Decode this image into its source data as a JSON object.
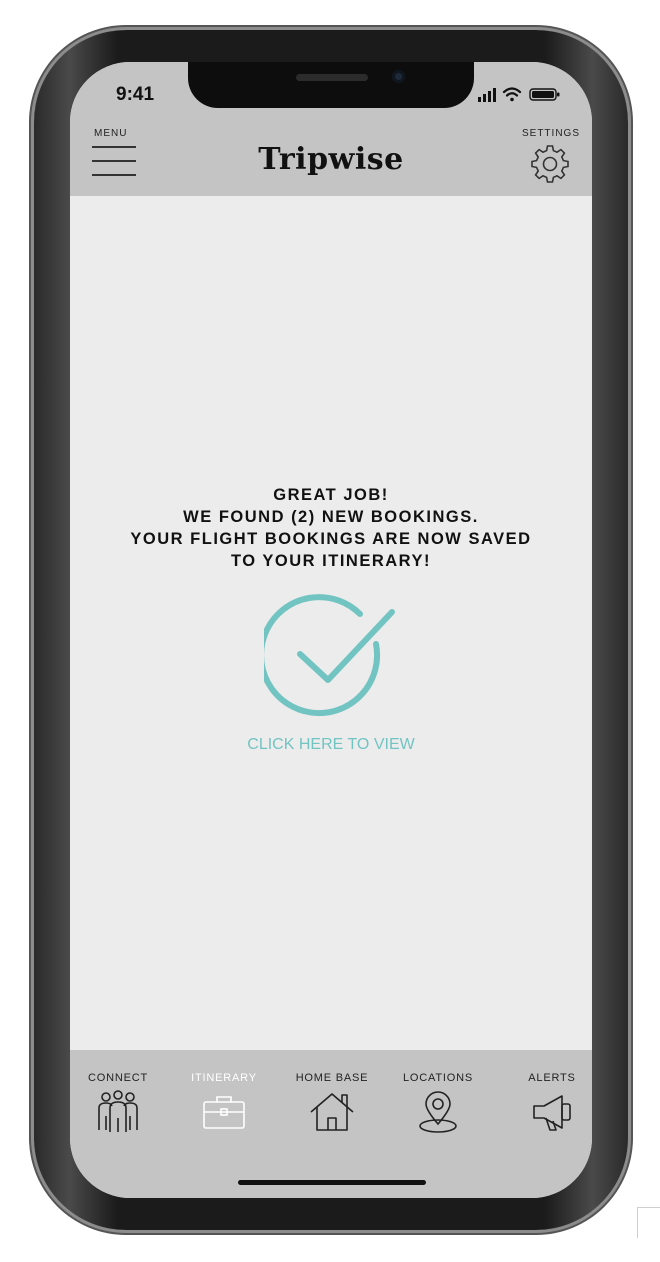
{
  "status_bar": {
    "time": "9:41"
  },
  "header": {
    "menu_label": "MENU",
    "settings_label": "SETTINGS",
    "app_title": "Tripwise"
  },
  "main": {
    "message_lines": [
      "GREAT JOB!",
      "WE FOUND (2) NEW BOOKINGS.",
      "YOUR FLIGHT BOOKINGS ARE NOW SAVED",
      "TO YOUR ITINERARY!"
    ],
    "view_link": "CLICK HERE TO VIEW",
    "accent_color": "#71c4c2"
  },
  "tabbar": {
    "active_tab": "itinerary",
    "tabs": [
      {
        "id": "connect",
        "label": "CONNECT",
        "icon": "people-icon"
      },
      {
        "id": "itinerary",
        "label": "ITINERARY",
        "icon": "briefcase-icon"
      },
      {
        "id": "home_base",
        "label": "HOME BASE",
        "icon": "house-icon"
      },
      {
        "id": "locations",
        "label": "LOCATIONS",
        "icon": "map-pin-icon"
      },
      {
        "id": "alerts",
        "label": "ALERTS",
        "icon": "megaphone-icon"
      }
    ]
  }
}
